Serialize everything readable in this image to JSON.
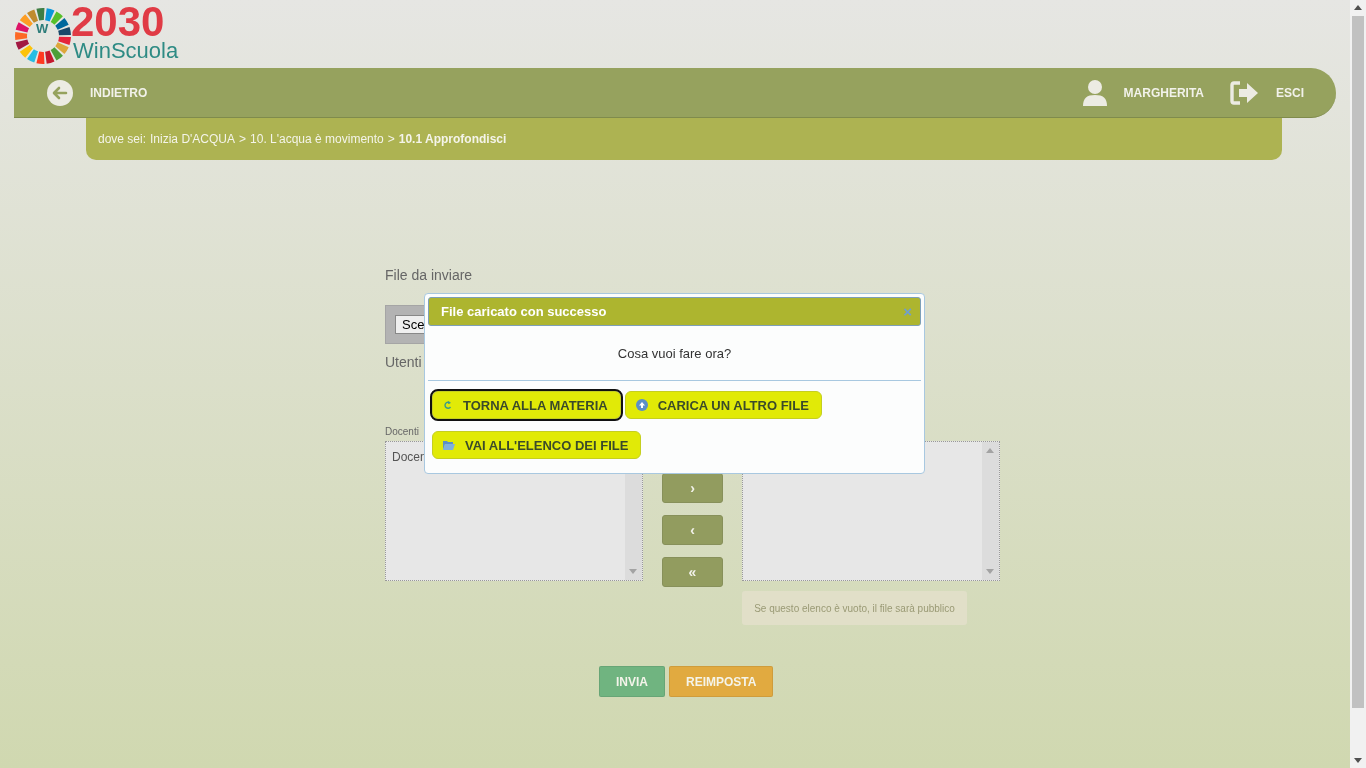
{
  "logo": {
    "badge": "W",
    "year": "2030",
    "name": "WinScuola"
  },
  "header": {
    "back": "INDIETRO",
    "user": "MARGHERITA",
    "logout": "ESCI"
  },
  "breadcrumb": {
    "prefix": "dove sei:",
    "items": [
      "Inizia D'ACQUA",
      "10. L'acqua è movimento",
      "10.1 Approfondisci"
    ],
    "separator": ">"
  },
  "form": {
    "file_label": "File da inviare",
    "file_button": "Sce",
    "users_label": "Utenti",
    "list_label": "Docenti",
    "left_list": [
      "Docen"
    ],
    "move_buttons": [
      "›",
      "‹",
      "«"
    ],
    "note": "Se questo elenco è vuoto, il file sarà pubblico",
    "submit": "INVIA",
    "reset": "REIMPOSTA"
  },
  "dialog": {
    "title": "File caricato con successo",
    "close": "×",
    "question": "Cosa vuoi fare ora?",
    "actions": [
      {
        "kind": "back",
        "label": "TORNA ALLA MATERIA",
        "selected": true
      },
      {
        "kind": "upload",
        "label": "CARICA UN ALTRO FILE",
        "selected": false
      },
      {
        "kind": "folder",
        "label": "VAI ALL'ELENCO DEI FILE",
        "selected": false
      }
    ]
  }
}
